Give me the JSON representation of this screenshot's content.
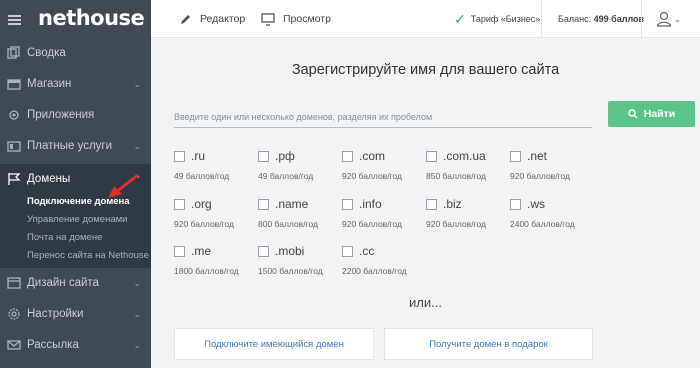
{
  "brand": {
    "logo_text": "nethouse"
  },
  "sidebar": {
    "items": [
      {
        "label": "Сводка",
        "icon": "copy-icon",
        "has_chevron": false
      },
      {
        "label": "Магазин",
        "icon": "store-icon",
        "has_chevron": true
      },
      {
        "label": "Приложения",
        "icon": "gear-icon",
        "has_chevron": false
      },
      {
        "label": "Платные услуги",
        "icon": "wallet-icon",
        "has_chevron": true
      },
      {
        "label": "Домены",
        "icon": "flag-icon",
        "has_chevron": true
      },
      {
        "label": "Дизайн сайта",
        "icon": "design-icon",
        "has_chevron": true
      },
      {
        "label": "Настройки",
        "icon": "settings-icon",
        "has_chevron": true
      },
      {
        "label": "Рассылка",
        "icon": "mail-icon",
        "has_chevron": true
      }
    ],
    "domains_sub": [
      {
        "label": "Подключение домена",
        "active": true
      },
      {
        "label": "Управление доменами",
        "active": false
      },
      {
        "label": "Почта на домене",
        "active": false
      },
      {
        "label": "Перенос сайта на Nethouse",
        "active": false
      }
    ]
  },
  "topbar": {
    "editor_label": "Редактор",
    "preview_label": "Просмотр",
    "tariff_label": "Тариф «Бизнес»",
    "balance_prefix": "Баланс:",
    "balance_value": "499 баллов"
  },
  "main": {
    "title": "Зарегистрируйте имя для вашего сайта",
    "search_placeholder": "Введите один или несколько доменов, разделяя их пробелом",
    "find_label": "Найти",
    "domains": [
      {
        "zone": ".ru",
        "price": "49 баллов/год"
      },
      {
        "zone": ".рф",
        "price": "49 баллов/год"
      },
      {
        "zone": ".com",
        "price": "920 баллов/год"
      },
      {
        "zone": ".com.ua",
        "price": "850 баллов/год"
      },
      {
        "zone": ".net",
        "price": "920 баллов/год"
      },
      {
        "zone": ".org",
        "price": "920 баллов/год"
      },
      {
        "zone": ".name",
        "price": "800 баллов/год"
      },
      {
        "zone": ".info",
        "price": "920 баллов/год"
      },
      {
        "zone": ".biz",
        "price": "920 баллов/год"
      },
      {
        "zone": ".ws",
        "price": "2400 баллов/год"
      },
      {
        "zone": ".me",
        "price": "1800 баллов/год"
      },
      {
        "zone": ".mobi",
        "price": "1500 баллов/год"
      },
      {
        "zone": ".cc",
        "price": "2200 баллов/год"
      }
    ],
    "or_text": "или...",
    "connect_existing_label": "Подключите имеющийся домен",
    "gift_domain_label": "Получите домен в подарок"
  },
  "colors": {
    "sidebar_bg": "#3f4a55",
    "accent_green": "#5ac48a",
    "link_blue": "#3f79b8",
    "arrow_red": "#e52b2b"
  }
}
